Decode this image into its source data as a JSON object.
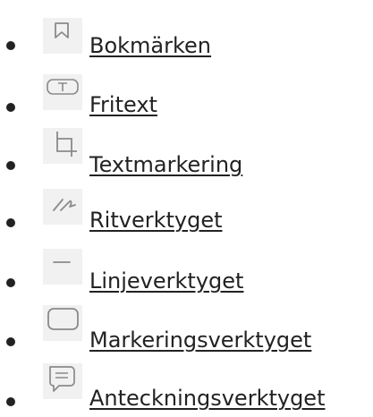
{
  "tools": {
    "items": [
      {
        "label": "Bokmärken",
        "icon": "bookmark-icon"
      },
      {
        "label": "Fritext",
        "icon": "free-text-icon"
      },
      {
        "label": "Textmarkering",
        "icon": "crop-icon"
      },
      {
        "label": "Ritverktyget",
        "icon": "draw-icon"
      },
      {
        "label": "Linjeverktyget",
        "icon": "line-icon"
      },
      {
        "label": "Markeringsverktyget",
        "icon": "rectangle-icon"
      },
      {
        "label": "Anteckningsverktyget",
        "icon": "comment-icon"
      }
    ]
  },
  "colors": {
    "text": "#222222",
    "icon": "#8a8a8a",
    "icon_background": "#f1f1f1"
  }
}
